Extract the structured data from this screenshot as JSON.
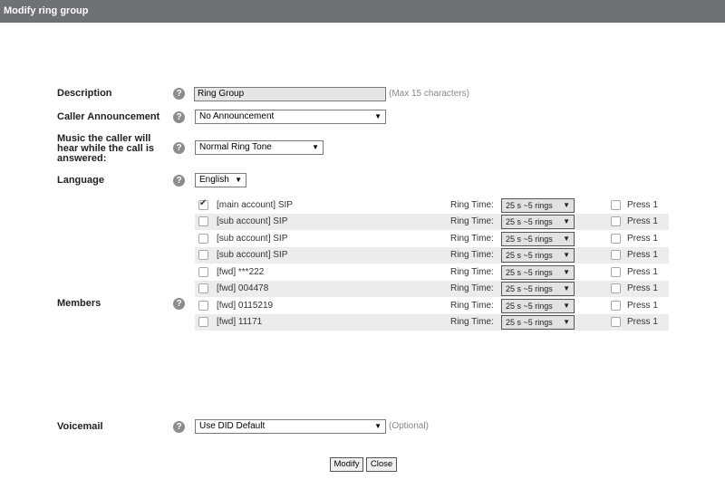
{
  "window": {
    "title": "Modify ring group"
  },
  "form": {
    "description": {
      "label": "Description",
      "value": "Ring Group",
      "hint": "(Max 15 characters)"
    },
    "announcement": {
      "label": "Caller Announcement",
      "selected": "No Announcement"
    },
    "music": {
      "label_line1": "Music the caller will",
      "label_line2": "hear while the call is",
      "label_line3": "answered:",
      "selected": "Normal Ring Tone"
    },
    "language": {
      "label": "Language",
      "selected": "English"
    },
    "members": {
      "label": "Members",
      "ring_time_label": "Ring Time:",
      "press_label": "Press 1",
      "rows": [
        {
          "name": "[main account] SIP",
          "checked": true,
          "ring_time": "25 s ~5 rings",
          "press1": false
        },
        {
          "name": "[sub account] SIP",
          "checked": false,
          "ring_time": "25 s ~5 rings",
          "press1": false
        },
        {
          "name": "[sub account] SIP",
          "checked": false,
          "ring_time": "25 s ~5 rings",
          "press1": false
        },
        {
          "name": "[sub account] SIP",
          "checked": false,
          "ring_time": "25 s ~5 rings",
          "press1": false
        },
        {
          "name": "[fwd] ***222",
          "checked": false,
          "ring_time": "25 s ~5 rings",
          "press1": false
        },
        {
          "name": "[fwd] 004478",
          "checked": false,
          "ring_time": "25 s ~5 rings",
          "press1": false
        },
        {
          "name": "[fwd] 0115219",
          "checked": false,
          "ring_time": "25 s ~5 rings",
          "press1": false
        },
        {
          "name": "[fwd] 11171",
          "checked": false,
          "ring_time": "25 s ~5 rings",
          "press1": false
        }
      ]
    },
    "voicemail": {
      "label": "Voicemail",
      "selected": "Use DID Default",
      "hint": "(Optional)"
    }
  },
  "buttons": {
    "modify": "Modify",
    "close": "Close"
  },
  "icons": {
    "help": "question-mark-icon",
    "dropdown": "triangle-down-icon"
  },
  "colors": {
    "titlebar": "#6e7276",
    "row_shade": "#ececec"
  }
}
